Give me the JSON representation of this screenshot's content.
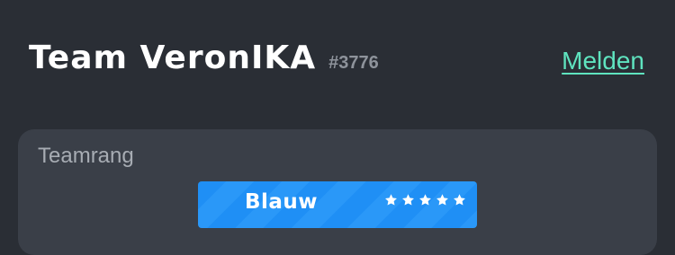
{
  "header": {
    "team_name": "Team VeronIKA",
    "team_id": "#3776",
    "report_label": "Melden"
  },
  "card": {
    "label": "Teamrang",
    "rank": {
      "name": "Blauw",
      "stars": 5,
      "star_icon": "star-icon",
      "color": "#1f8ff5"
    }
  }
}
